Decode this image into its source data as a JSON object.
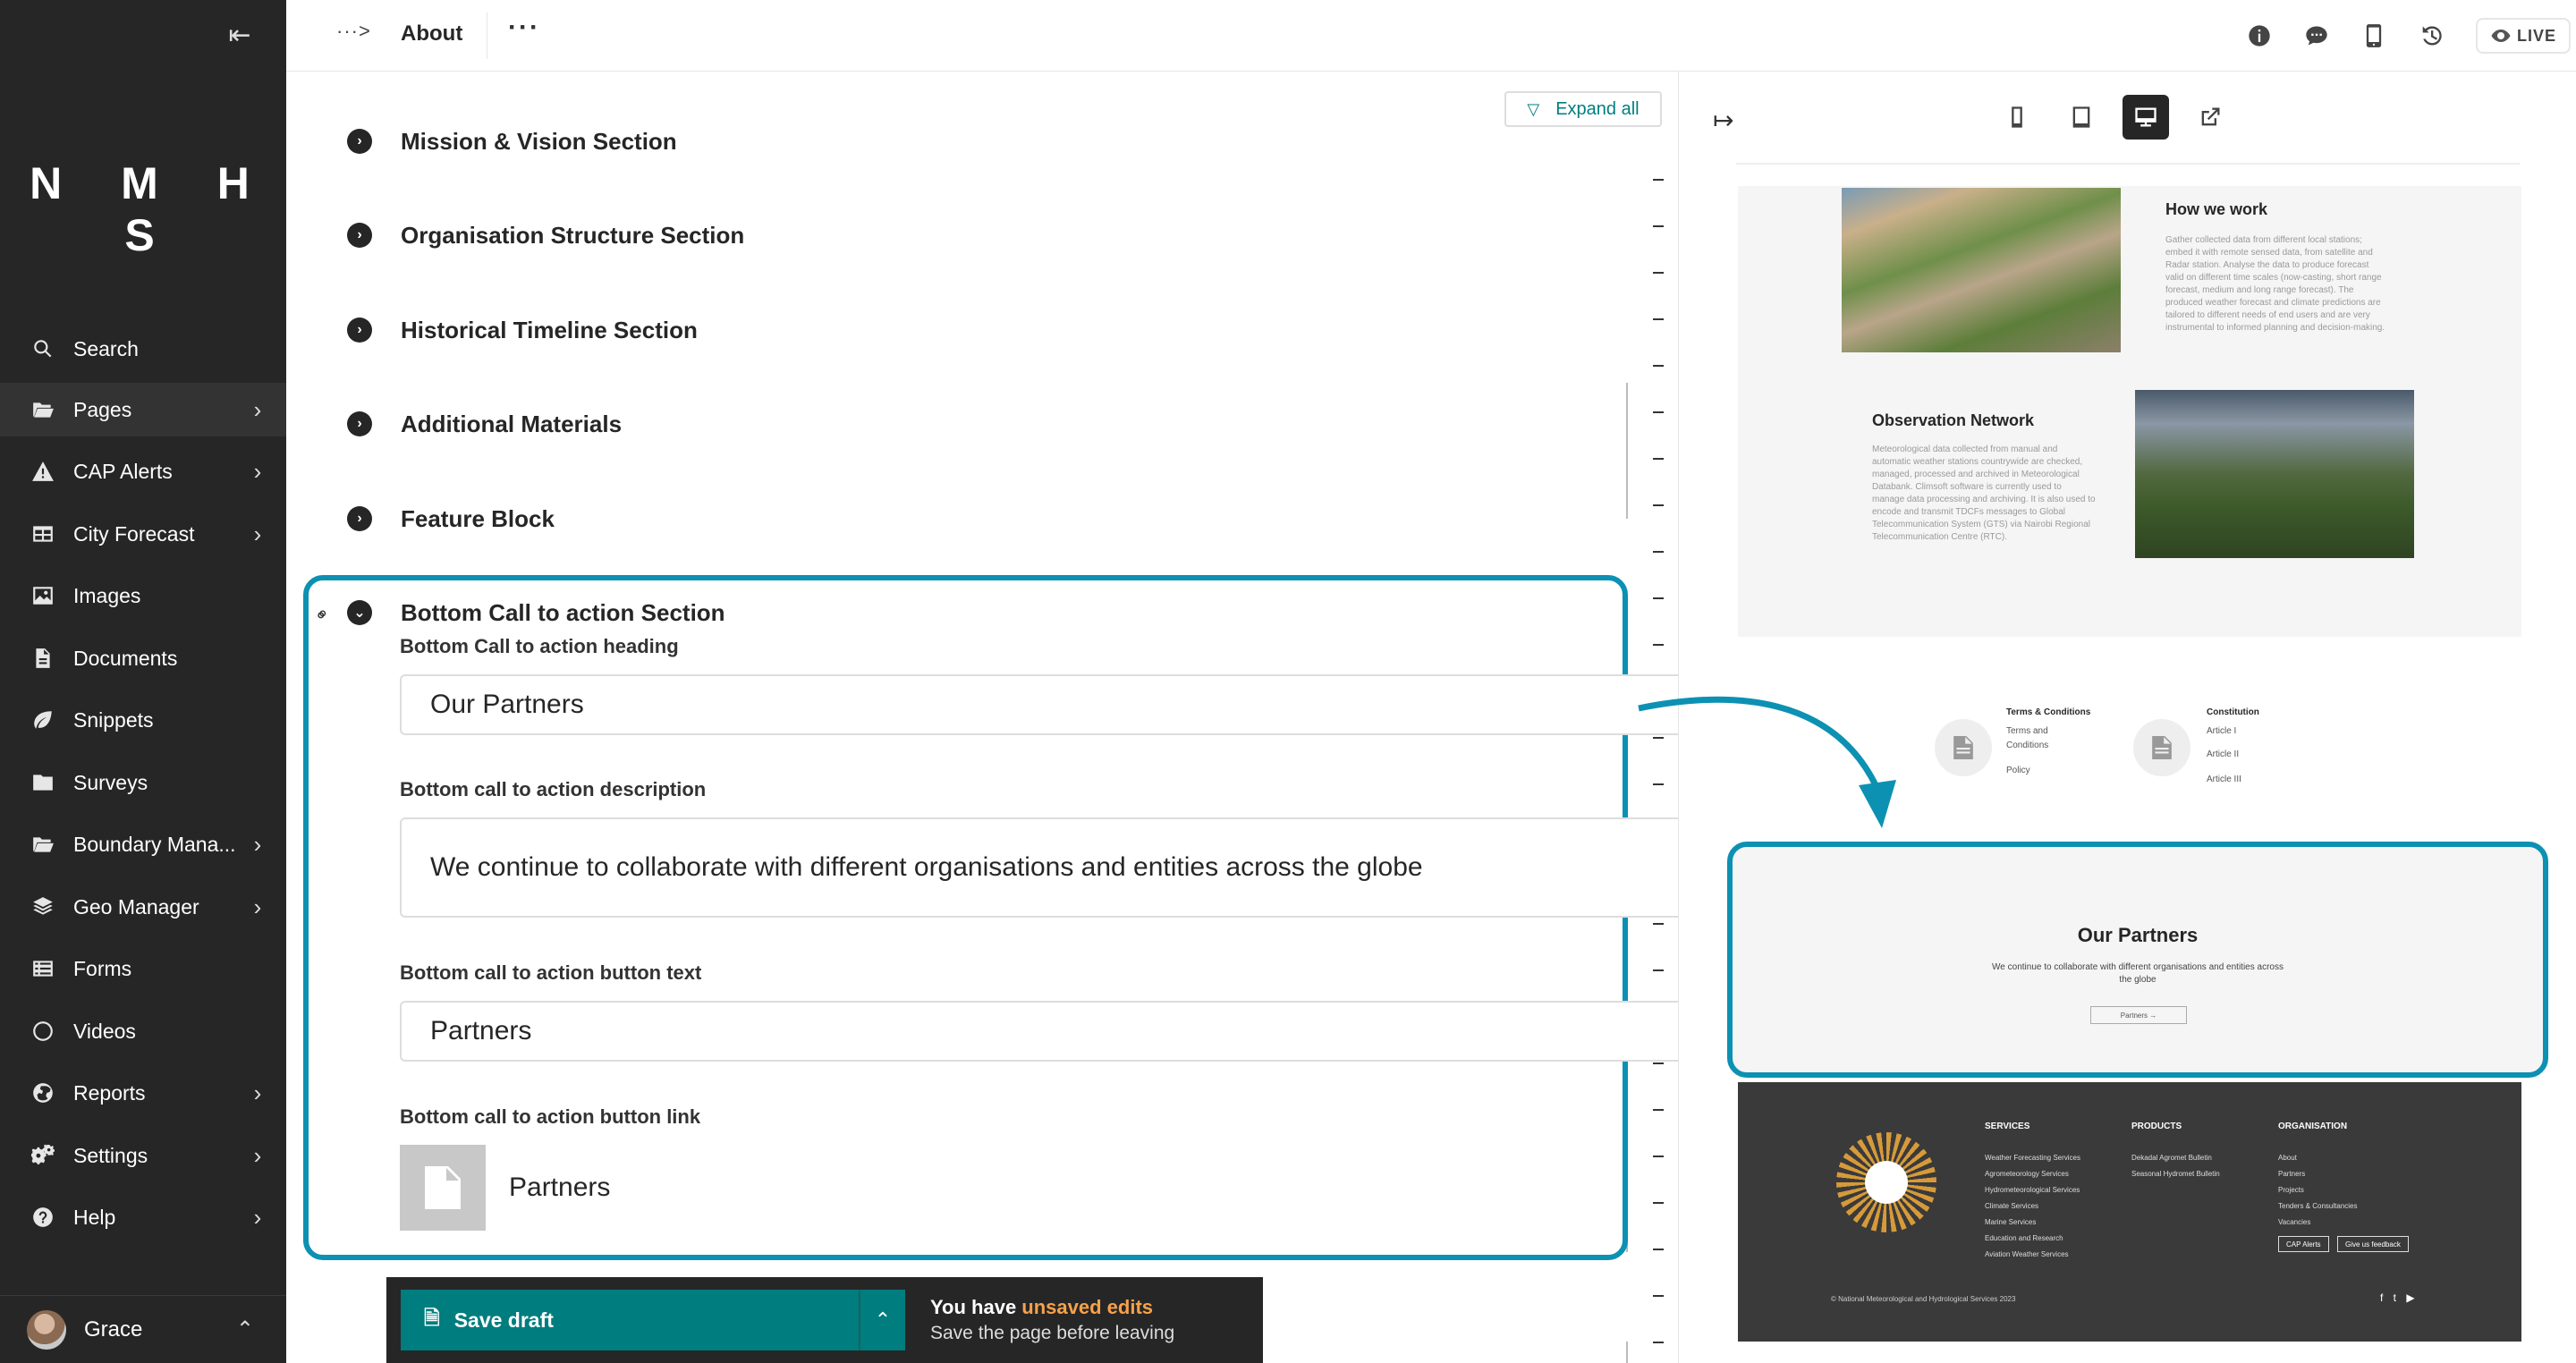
{
  "sidebar": {
    "logo": "N M H S",
    "items": [
      {
        "label": "Search",
        "icon": "search-icon",
        "has_children": false
      },
      {
        "label": "Pages",
        "icon": "folder-open-icon",
        "has_children": true
      },
      {
        "label": "CAP Alerts",
        "icon": "warning-icon",
        "has_children": true
      },
      {
        "label": "City Forecast",
        "icon": "table-icon",
        "has_children": true
      },
      {
        "label": "Images",
        "icon": "image-icon",
        "has_children": false
      },
      {
        "label": "Documents",
        "icon": "document-icon",
        "has_children": false
      },
      {
        "label": "Snippets",
        "icon": "snippet-icon",
        "has_children": false
      },
      {
        "label": "Surveys",
        "icon": "folder-icon",
        "has_children": false
      },
      {
        "label": "Boundary Mana...",
        "icon": "folder-open-icon",
        "has_children": true
      },
      {
        "label": "Geo Manager",
        "icon": "layers-icon",
        "has_children": true
      },
      {
        "label": "Forms",
        "icon": "list-icon",
        "has_children": false
      },
      {
        "label": "Videos",
        "icon": "circle-icon",
        "has_children": false
      },
      {
        "label": "Reports",
        "icon": "globe-icon",
        "has_children": true
      },
      {
        "label": "Settings",
        "icon": "cogs-icon",
        "has_children": true
      },
      {
        "label": "Help",
        "icon": "help-icon",
        "has_children": true
      }
    ],
    "user": {
      "name": "Grace"
    }
  },
  "header": {
    "breadcrumb_toggle": "···>",
    "title": "About",
    "more": "···",
    "live_label": "LIVE"
  },
  "editor": {
    "expand_all": "Expand all",
    "sections": [
      {
        "title": "Mission & Vision Section"
      },
      {
        "title": "Organisation Structure Section"
      },
      {
        "title": "Historical Timeline Section"
      },
      {
        "title": "Additional Materials"
      },
      {
        "title": "Feature Block"
      },
      {
        "title": "Bottom Call to action Section"
      }
    ],
    "bottom_cta": {
      "heading_label": "Bottom Call to action heading",
      "heading_value": "Our Partners",
      "description_label": "Bottom call to action description",
      "description_value": "We continue to collaborate with different organisations and entities across the globe",
      "button_text_label": "Bottom call to action button text",
      "button_text_value": "Partners",
      "button_link_label": "Bottom call to action button link",
      "button_link_value": "Partners"
    }
  },
  "save_bar": {
    "save_label": "Save draft",
    "status_prefix": "You have ",
    "status_highlight": "unsaved edits",
    "status_sub": "Save the page before leaving"
  },
  "preview": {
    "how_we_work": {
      "title": "How we work",
      "text": "Gather collected data from different local stations; embed it with remote sensed data, from satellite and Radar station. Analyse the data to produce forecast valid on different time scales (now-casting, short range forecast, medium and long range forecast). The produced weather forecast and climate predictions are tailored to different needs of end users and are very instrumental to informed planning and decision-making."
    },
    "observation": {
      "title": "Observation Network",
      "text": "Meteorological data collected from manual and automatic weather stations countrywide are checked, managed, processed and archived in Meteorological Databank. Climsoft software is currently used to manage data processing and archiving. It is also used to encode and transmit TDCFs messages to Global Telecommunication System (GTS) via Nairobi Regional Telecommunication Centre (RTC)."
    },
    "downloads": {
      "group1_title": "Terms & Conditions",
      "group1_items": [
        "Terms and Conditions",
        "Policy"
      ],
      "group2_title": "Constitution",
      "group2_items": [
        "Article I",
        "Article II",
        "Article III"
      ]
    },
    "cta": {
      "title": "Our Partners",
      "desc": "We continue to collaborate with different organisations and entities across the globe",
      "button": "Partners →"
    },
    "footer": {
      "services_title": "SERVICES",
      "services": [
        "Weather Forecasting Services",
        "Agrometeorology Services",
        "Hydrometeorological Services",
        "Climate Services",
        "Marine Services",
        "Education and Research",
        "Aviation Weather Services"
      ],
      "products_title": "PRODUCTS",
      "products": [
        "Dekadal Agromet Bulletin",
        "Seasonal Hydromet Bulletin"
      ],
      "org_title": "ORGANISATION",
      "org": [
        "About",
        "Partners",
        "Projects",
        "Tenders & Consultancies",
        "Vacancies"
      ],
      "btn_cap": "CAP Alerts",
      "btn_feedback": "Give us feedback",
      "copyright": "© National Meteorological and Hydrological Services 2023",
      "social": "f t ▶"
    }
  },
  "colors": {
    "sidebar_bg": "#262626",
    "accent_teal": "#007d7e",
    "highlight_blue": "#0c91b3",
    "warning_orange": "#f8a14a"
  }
}
